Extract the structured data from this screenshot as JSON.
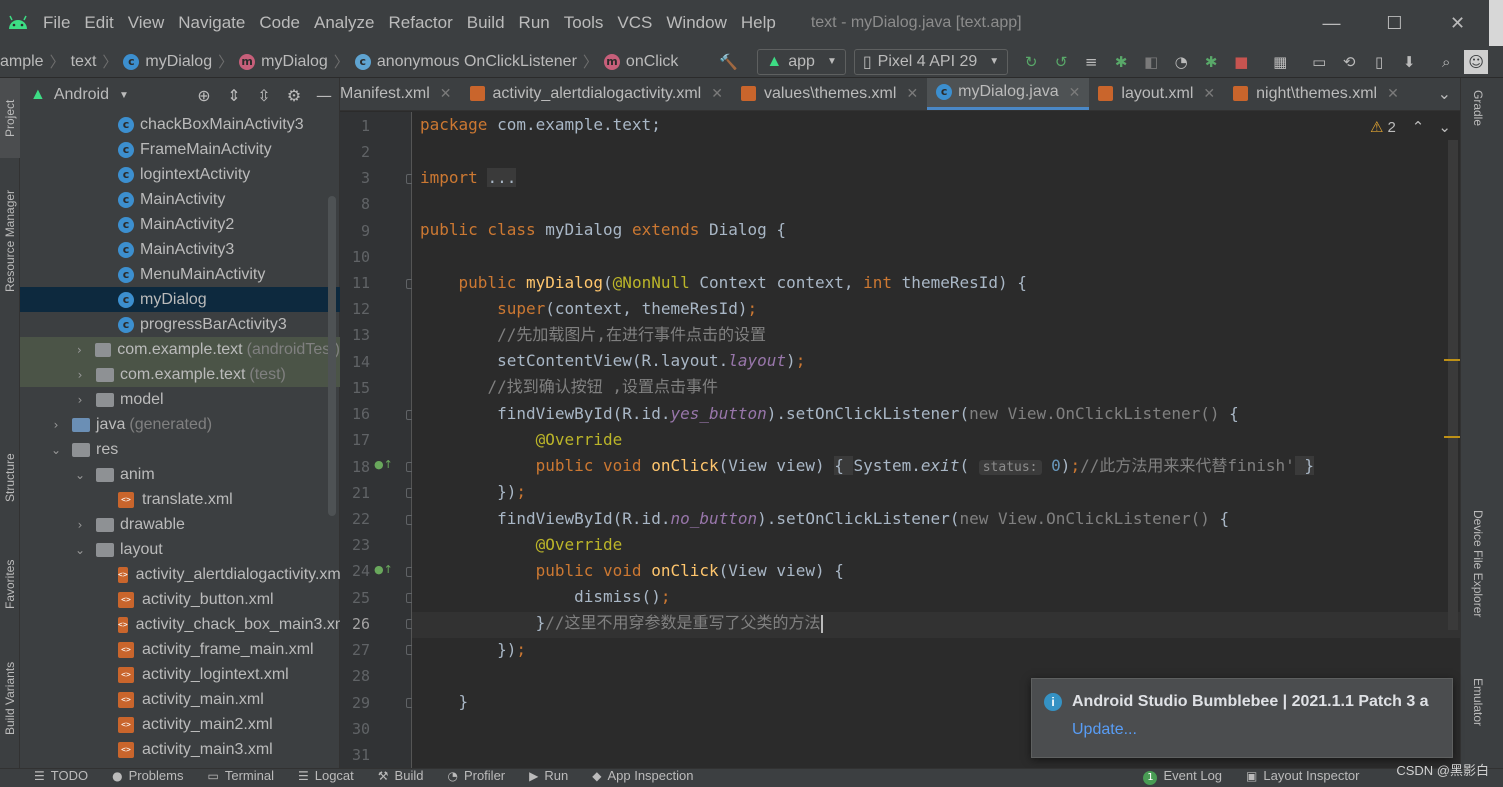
{
  "titlebar": {
    "menu": [
      "File",
      "Edit",
      "View",
      "Navigate",
      "Code",
      "Analyze",
      "Refactor",
      "Build",
      "Run",
      "Tools",
      "VCS",
      "Window",
      "Help"
    ],
    "window_title": "text - myDialog.java [text.app]",
    "minimize": "—",
    "maximize": "☐",
    "close": "✕"
  },
  "navbar": {
    "crumbs": [
      "ample",
      "text",
      "myDialog",
      "myDialog",
      "anonymous OnClickListener",
      "onClick"
    ],
    "config": "app",
    "device": "Pixel 4 API 29"
  },
  "left_tabs": [
    "Project",
    "Resource Manager",
    "Structure",
    "Favorites",
    "Build Variants"
  ],
  "right_tabs": [
    "Gradle",
    "Device File Explorer",
    "Emulator"
  ],
  "project": {
    "view": "Android",
    "items": [
      {
        "label": "chackBoxMainActivity3",
        "kind": "class"
      },
      {
        "label": "FrameMainActivity",
        "kind": "class"
      },
      {
        "label": "logintextActivity",
        "kind": "class"
      },
      {
        "label": "MainActivity",
        "kind": "class"
      },
      {
        "label": "MainActivity2",
        "kind": "class"
      },
      {
        "label": "MainActivity3",
        "kind": "class"
      },
      {
        "label": "MenuMainActivity",
        "kind": "class"
      },
      {
        "label": "myDialog",
        "kind": "class"
      },
      {
        "label": "progressBarActivity3",
        "kind": "class"
      },
      {
        "label": "com.example.text",
        "muted": "(androidTest)",
        "kind": "package"
      },
      {
        "label": "com.example.text",
        "muted": "(test)",
        "kind": "package"
      },
      {
        "label": "model",
        "kind": "folder"
      },
      {
        "label": "java",
        "muted": "(generated)",
        "kind": "folder"
      },
      {
        "label": "res",
        "kind": "folder"
      },
      {
        "label": "anim",
        "kind": "folder"
      },
      {
        "label": "translate.xml",
        "kind": "xml"
      },
      {
        "label": "drawable",
        "kind": "folder"
      },
      {
        "label": "layout",
        "kind": "folder"
      },
      {
        "label": "activity_alertdialogactivity.xml",
        "kind": "xml"
      },
      {
        "label": "activity_button.xml",
        "kind": "xml"
      },
      {
        "label": "activity_chack_box_main3.xml",
        "kind": "xml"
      },
      {
        "label": "activity_frame_main.xml",
        "kind": "xml"
      },
      {
        "label": "activity_logintext.xml",
        "kind": "xml"
      },
      {
        "label": "activity_main.xml",
        "kind": "xml"
      },
      {
        "label": "activity_main2.xml",
        "kind": "xml"
      },
      {
        "label": "activity_main3.xml",
        "kind": "xml"
      }
    ]
  },
  "tabs": [
    {
      "label": "Manifest.xml"
    },
    {
      "label": "activity_alertdialogactivity.xml"
    },
    {
      "label": "values\\themes.xml"
    },
    {
      "label": "myDialog.java"
    },
    {
      "label": "layout.xml"
    },
    {
      "label": "night\\themes.xml"
    }
  ],
  "editor": {
    "line_numbers": [
      "1",
      "2",
      "3",
      "8",
      "9",
      "10",
      "11",
      "12",
      "13",
      "14",
      "15",
      "16",
      "17",
      "18",
      "21",
      "22",
      "23",
      "24",
      "25",
      "26",
      "27",
      "28",
      "29",
      "30",
      "31"
    ],
    "warnings": "2",
    "line1_pkg": "com.example.text;",
    "line3_fold": "...",
    "comment13": "//先加载图片,在进行事件点击的设置",
    "comment15": "//找到确认按钮 ,设置点击事件",
    "hint_status": "status:",
    "comment18": "//此方法用来来代替finish'",
    "comment26": "//这里不用穿参数是重写了父类的方法"
  },
  "notification": {
    "title": "Android Studio Bumblebee | 2021.1.1 Patch 3 a",
    "link": "Update..."
  },
  "bottombar": [
    "TODO",
    "Problems",
    "Terminal",
    "Logcat",
    "Build",
    "Profiler",
    "Run",
    "App Inspection",
    "Event Log",
    "Layout Inspector"
  ],
  "event_count": "1",
  "watermark": "CSDN @黑影白"
}
